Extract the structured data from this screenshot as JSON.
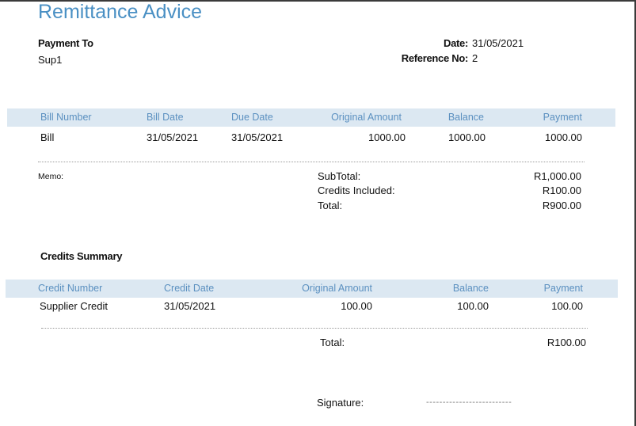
{
  "title": "Remittance Advice",
  "payment_to": {
    "label": "Payment To",
    "value": "Sup1"
  },
  "date": {
    "label": "Date:",
    "value": "31/05/2021"
  },
  "reference": {
    "label": "Reference No:",
    "value": "2"
  },
  "bills": {
    "headers": [
      "Bill Number",
      "Bill Date",
      "Due Date",
      "Original Amount",
      "Balance",
      "Payment"
    ],
    "rows": [
      [
        "Bill",
        "31/05/2021",
        "31/05/2021",
        "1000.00",
        "1000.00",
        "1000.00"
      ]
    ]
  },
  "memo": {
    "label": "Memo:"
  },
  "totals": {
    "subtotal_label": "SubTotal:",
    "subtotal_value": "R1,000.00",
    "credits_label": "Credits Included:",
    "credits_value": "R100.00",
    "total_label": "Total:",
    "total_value": "R900.00"
  },
  "credits_summary": {
    "title": "Credits Summary",
    "headers": [
      "Credit Number",
      "Credit Date",
      "Original Amount",
      "Balance",
      "Payment"
    ],
    "rows": [
      [
        "Supplier Credit",
        "31/05/2021",
        "100.00",
        "100.00",
        "100.00"
      ]
    ],
    "total_label": "Total:",
    "total_value": "R100.00"
  },
  "signature": {
    "label": "Signature:",
    "line": "--------------------------"
  }
}
